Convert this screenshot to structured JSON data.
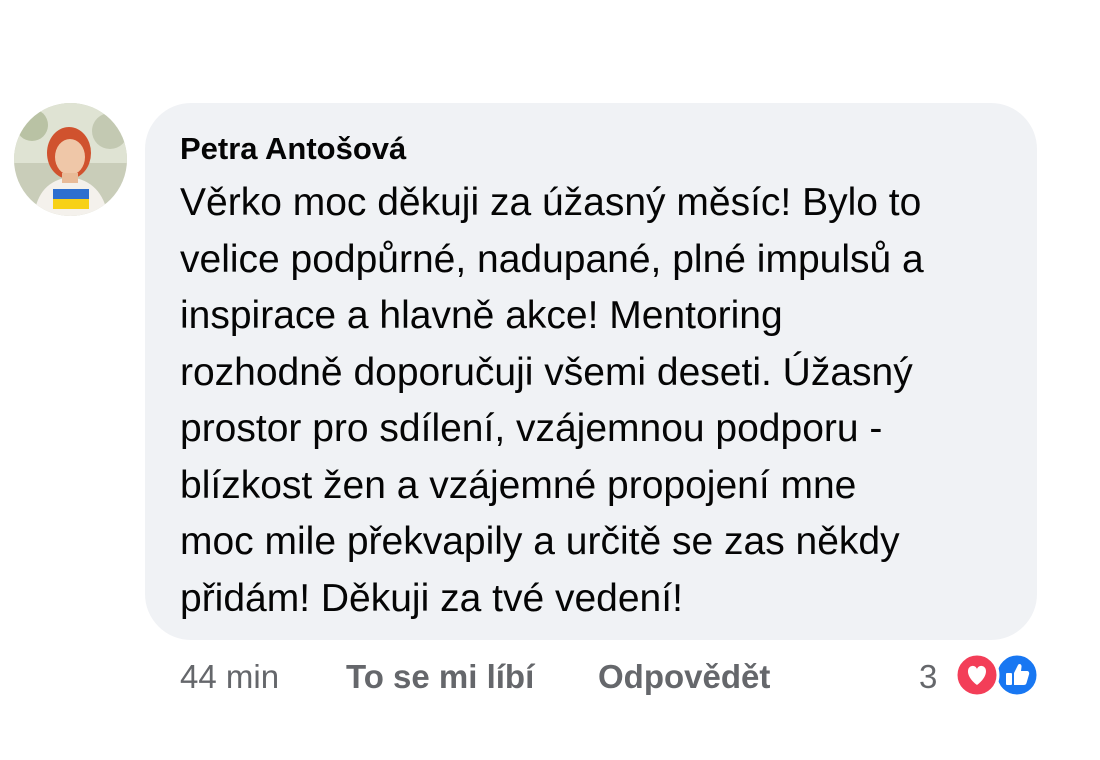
{
  "comment": {
    "author": "Petra Antošová",
    "lines": [
      "Věrko moc děkuji za úžasný měsíc! Bylo to",
      "velice podpůrné, nadupané, plné impulsů a",
      "inspirace a hlavně akce! Mentoring",
      "rozhodně doporučuji všemi deseti. Úžasný",
      "prostor pro sdílení, vzájemnou podporu -",
      "blízkost žen a vzájemné propojení mne",
      "moc mile překvapily a určitě se zas někdy",
      "přidám! Děkuji za tvé vedení!"
    ]
  },
  "actions": {
    "time": "44 min",
    "like_label": "To se mi líbí",
    "reply_label": "Odpovědět",
    "reaction_count": "3"
  },
  "icons": {
    "love": "heart-icon",
    "like": "thumbs-up-icon"
  },
  "colors": {
    "bubble_bg": "#f0f2f5",
    "text": "#050505",
    "secondary_text": "#65676b",
    "love_red": "#f33e58",
    "like_blue": "#1877f2"
  }
}
